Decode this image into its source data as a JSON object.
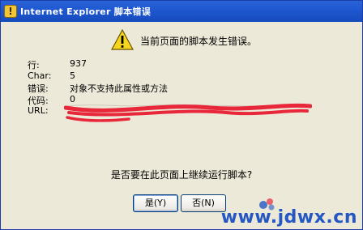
{
  "window": {
    "title": "Internet Explorer 脚本错误"
  },
  "dialog": {
    "header": "当前页面的脚本发生错误。",
    "fields": [
      {
        "label": "行:",
        "value": "937"
      },
      {
        "label": "Char:",
        "value": "5"
      },
      {
        "label": "错误:",
        "value": "对象不支持此属性或方法"
      },
      {
        "label": "代码:",
        "value": "0"
      },
      {
        "label": "URL:",
        "value": ""
      }
    ],
    "question": "是否要在此页面上继续运行脚本?",
    "buttons": {
      "yes": "是(Y)",
      "no": "否(N)"
    }
  },
  "watermark": {
    "text": "www.jdwx.cn"
  },
  "colors": {
    "titlebar": "#1f58d0",
    "dialog_bg": "#ece9d8",
    "redaction": "#e8283a",
    "watermark": "#2457c4"
  }
}
